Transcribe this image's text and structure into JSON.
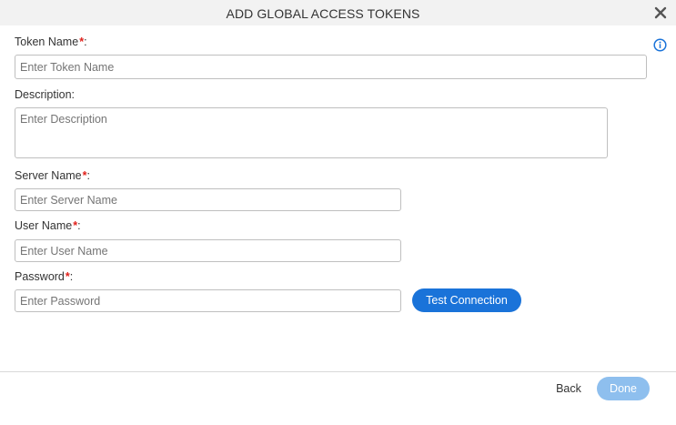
{
  "dialog": {
    "title": "ADD GLOBAL ACCESS TOKENS",
    "close_icon": "close-icon",
    "info_icon": "info-icon"
  },
  "form": {
    "token_name": {
      "label": "Token Name",
      "required_mark": "*",
      "suffix": ":",
      "placeholder": "Enter Token Name",
      "value": ""
    },
    "description": {
      "label": "Description:",
      "placeholder": "Enter Description",
      "value": ""
    },
    "server_name": {
      "label": "Server Name",
      "required_mark": "*",
      "suffix": ":",
      "placeholder": "Enter Server Name",
      "value": ""
    },
    "user_name": {
      "label": "User Name",
      "required_mark": "*",
      "suffix": ":",
      "placeholder": "Enter User Name",
      "value": ""
    },
    "password": {
      "label": "Password",
      "required_mark": "*",
      "suffix": ":",
      "placeholder": "Enter Password",
      "value": ""
    },
    "test_connection_label": "Test Connection"
  },
  "footer": {
    "back_label": "Back",
    "done_label": "Done",
    "done_enabled": false
  },
  "colors": {
    "primary": "#1a73d9",
    "primary_disabled": "#8ebfee",
    "required": "#e0201a",
    "header_bg": "#f2f2f2"
  }
}
